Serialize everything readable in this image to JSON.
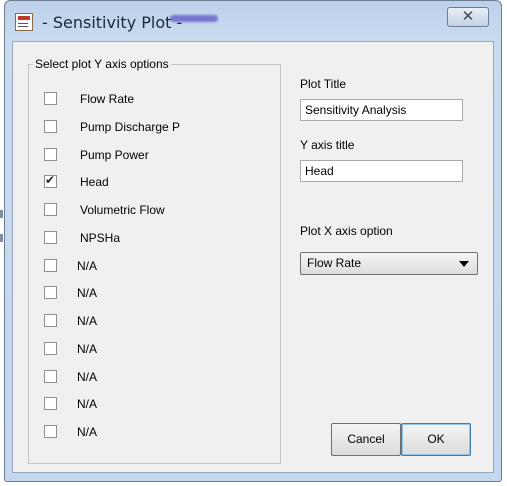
{
  "window": {
    "title": "- Sensitivity Plot -",
    "close_icon": "close-x-icon"
  },
  "y_axis_group": {
    "legend": "Select plot Y axis options",
    "options": [
      {
        "label": "Flow Rate",
        "checked": false
      },
      {
        "label": "Pump Discharge P",
        "checked": false
      },
      {
        "label": "Pump Power",
        "checked": false
      },
      {
        "label": "Head",
        "checked": true
      },
      {
        "label": "Volumetric Flow",
        "checked": false
      },
      {
        "label": "NPSHa",
        "checked": false
      },
      {
        "label": "N/A",
        "checked": false
      },
      {
        "label": "N/A",
        "checked": false
      },
      {
        "label": "N/A",
        "checked": false
      },
      {
        "label": "N/A",
        "checked": false
      },
      {
        "label": "N/A",
        "checked": false
      },
      {
        "label": "N/A",
        "checked": false
      },
      {
        "label": "N/A",
        "checked": false
      }
    ]
  },
  "plot_title": {
    "label": "Plot Title",
    "value": "Sensitivity Analysis"
  },
  "y_axis_title": {
    "label": "Y axis title",
    "value": "Head"
  },
  "x_axis_option": {
    "label": "Plot X axis option",
    "selected": "Flow Rate"
  },
  "buttons": {
    "cancel": "Cancel",
    "ok": "OK"
  }
}
